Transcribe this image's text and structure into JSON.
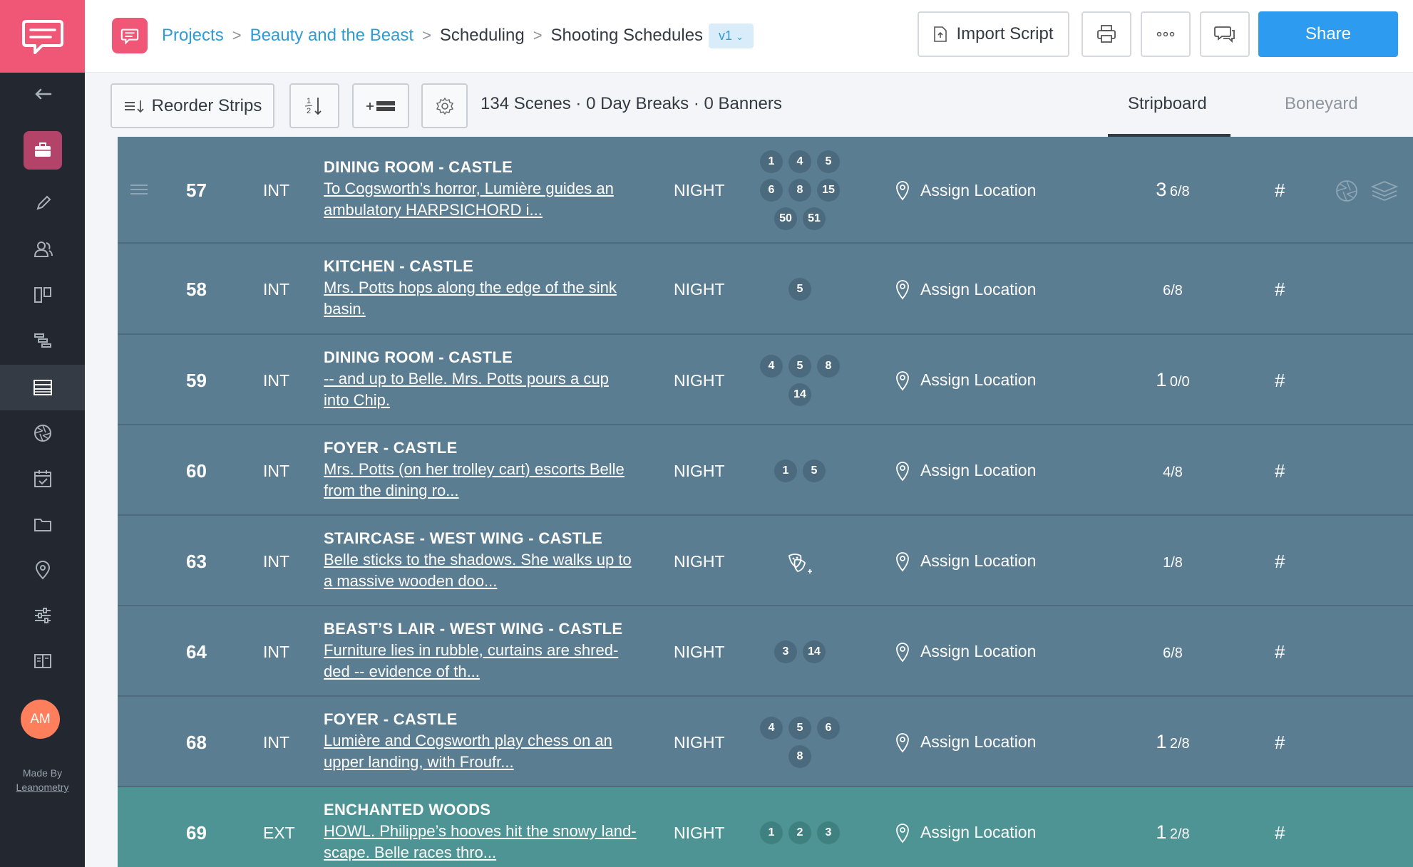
{
  "colors": {
    "sidebar_bg": "#232830",
    "brand_pink": "#f05776",
    "link_blue": "#2e9bd7",
    "share_blue": "#2d9cf0",
    "night_strip": "#5b7d92",
    "ext_strip": "#4f9494",
    "avatar_orange": "#ff7e5c"
  },
  "sidebar": {
    "logo": "chat-bubble-logo",
    "back_icon": "arrow-left-icon",
    "items": [
      {
        "icon": "briefcase-icon",
        "active": true
      },
      {
        "icon": "pencil-icon"
      },
      {
        "icon": "people-icon"
      },
      {
        "icon": "storyboard-icon"
      },
      {
        "icon": "gantt-icon"
      },
      {
        "icon": "stripboard-icon",
        "selected": true
      },
      {
        "icon": "aperture-icon"
      },
      {
        "icon": "calendar-check-icon"
      },
      {
        "icon": "folder-icon"
      },
      {
        "icon": "location-pin-icon"
      },
      {
        "icon": "sliders-icon"
      },
      {
        "icon": "book-icon"
      }
    ],
    "avatar": "AM",
    "made_by": "Made By",
    "made_by_company": "Leanometry"
  },
  "header": {
    "breadcrumb": {
      "projects": "Projects",
      "project": "Beauty and the Beast",
      "section": "Scheduling",
      "page": "Shooting Schedules"
    },
    "version": "v1",
    "import_label": "Import Script",
    "share_label": "Share"
  },
  "toolbar": {
    "reorder_label": "Reorder Strips",
    "summary": "134 Scenes · 0 Day Breaks · 0 Banners",
    "tabs": [
      "Stripboard",
      "Boneyard"
    ],
    "active_tab": "Stripboard"
  },
  "strips": [
    {
      "scene": "57",
      "ie": "INT",
      "set": "DINING ROOM - CASTLE",
      "desc_1": "To Cogsworth’s horror, Lumière guides an",
      "desc_2": "ambulatory HARPSICHORD i...",
      "time": "NIGHT",
      "cast": [
        "1",
        "4",
        "5",
        "6",
        "8",
        "15",
        "50",
        "51"
      ],
      "location": "Assign Location",
      "pages_whole": "3",
      "pages_frac": "6/8",
      "hash": "#",
      "type": "int"
    },
    {
      "scene": "58",
      "ie": "INT",
      "set": "KITCHEN - CASTLE",
      "desc_1": "Mrs. Potts hops along the edge of the sink",
      "desc_2": "basin.",
      "time": "NIGHT",
      "cast": [
        "5"
      ],
      "location": "Assign Location",
      "pages_whole": "",
      "pages_frac": "6/8",
      "hash": "#",
      "type": "int"
    },
    {
      "scene": "59",
      "ie": "INT",
      "set": "DINING ROOM - CASTLE",
      "desc_1": "-- and up to Belle. Mrs. Potts pours a cup",
      "desc_2": "into Chip.",
      "time": "NIGHT",
      "cast": [
        "4",
        "5",
        "8",
        "14"
      ],
      "location": "Assign Location",
      "pages_whole": "1",
      "pages_frac": "0/0",
      "hash": "#",
      "type": "int"
    },
    {
      "scene": "60",
      "ie": "INT",
      "set": "FOYER - CASTLE",
      "desc_1": "Mrs. Potts (on her trolley cart) escorts Belle",
      "desc_2": "from the dining ro...",
      "time": "NIGHT",
      "cast": [
        "1",
        "5"
      ],
      "location": "Assign Location",
      "pages_whole": "",
      "pages_frac": "4/8",
      "hash": "#",
      "type": "int"
    },
    {
      "scene": "63",
      "ie": "INT",
      "set": "STAIRCASE - WEST WING - CASTLE",
      "desc_1": "Belle sticks to the shadows. She walks up to",
      "desc_2": "a massive wooden doo...",
      "time": "NIGHT",
      "cast": [],
      "location": "Assign Location",
      "pages_whole": "",
      "pages_frac": "1/8",
      "hash": "#",
      "type": "int"
    },
    {
      "scene": "64",
      "ie": "INT",
      "set": "BEAST’S LAIR - WEST WING - CASTLE",
      "desc_1": "Furniture lies in rubble, curtains are shred-",
      "desc_2": "ded -- evidence of th...",
      "time": "NIGHT",
      "cast": [
        "3",
        "14"
      ],
      "location": "Assign Location",
      "pages_whole": "",
      "pages_frac": "6/8",
      "hash": "#",
      "type": "int"
    },
    {
      "scene": "68",
      "ie": "INT",
      "set": "FOYER - CASTLE",
      "desc_1": "Lumière and Cogsworth play chess on an",
      "desc_2": "upper landing, with Froufr...",
      "time": "NIGHT",
      "cast": [
        "4",
        "5",
        "6",
        "8"
      ],
      "location": "Assign Location",
      "pages_whole": "1",
      "pages_frac": "2/8",
      "hash": "#",
      "type": "int"
    },
    {
      "scene": "69",
      "ie": "EXT",
      "set": "ENCHANTED WOODS",
      "desc_1": "HOWL. Philippe’s hooves hit the snowy land-",
      "desc_2": "scape. Belle races thro...",
      "time": "NIGHT",
      "cast": [
        "1",
        "2",
        "3"
      ],
      "location": "Assign Location",
      "pages_whole": "1",
      "pages_frac": "2/8",
      "hash": "#",
      "type": "ext"
    }
  ]
}
